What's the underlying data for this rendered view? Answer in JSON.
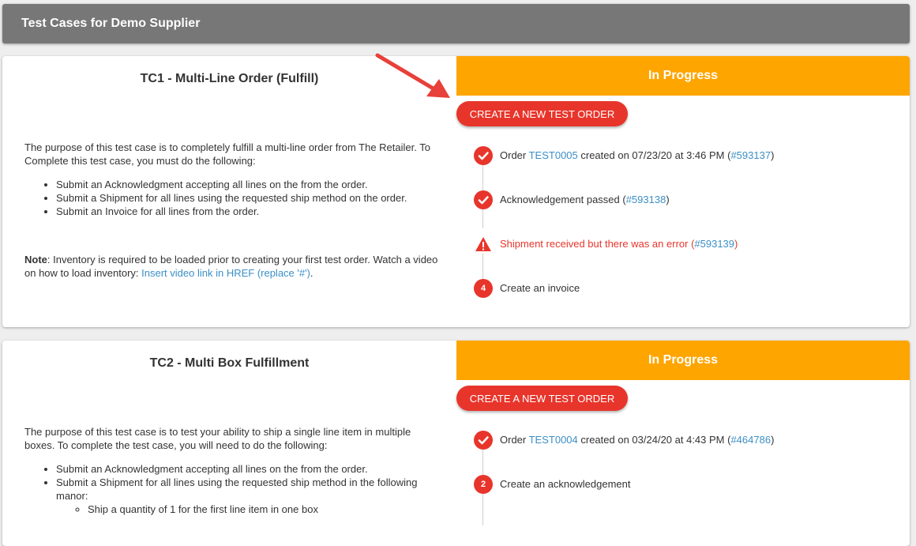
{
  "header": {
    "title": "Test Cases for Demo Supplier"
  },
  "colors": {
    "status": "#ffa500",
    "accent": "#e8352b",
    "link": "#3c8fc6",
    "header": "#777777"
  },
  "test_cases": [
    {
      "title": "TC1 - Multi-Line Order (Fulfill)",
      "status": "In Progress",
      "button_label": "CREATE A NEW TEST ORDER",
      "description": "The purpose of this test case is to completely fulfill a multi-line order from The Retailer. To Complete this test case, you must do the following:",
      "requirements": [
        "Submit an Acknowledgment accepting all lines on the from the order.",
        "Submit a Shipment for all lines using the requested ship method on the order.",
        "Submit an Invoice for all lines from the order."
      ],
      "note_label": "Note",
      "note_text": ": Inventory is required to be loaded prior to creating your first test order. Watch a video on how to load inventory: ",
      "note_link": "Insert video link in HREF (replace '#')",
      "note_end": ".",
      "steps": [
        {
          "state": "done",
          "icon": "check-icon",
          "pre": "Order ",
          "link1": "TEST0005",
          "mid": " created on 07/23/20 at 3:46 PM (",
          "link2": "#593137",
          "post": ")"
        },
        {
          "state": "done",
          "icon": "check-icon",
          "pre": "Acknowledgement passed (",
          "link2": "#593138",
          "post": ")"
        },
        {
          "state": "error",
          "icon": "warning-icon",
          "pre": "Shipment received but there was an error (",
          "link2": "#593139",
          "post": ")"
        },
        {
          "state": "pending",
          "number": "4",
          "pre": "Create an invoice"
        }
      ]
    },
    {
      "title": "TC2 - Multi Box Fulfillment",
      "status": "In Progress",
      "button_label": "CREATE A NEW TEST ORDER",
      "description": "The purpose of this test case is to test your ability to ship a single line item in multiple boxes. To complete the test case, you will need to do the following:",
      "requirements": [
        "Submit an Acknowledgment accepting all lines on the from the order.",
        "Submit a Shipment for all lines using the requested ship method in the following manor:"
      ],
      "sub_requirements": [
        "Ship a quantity of 1 for the first line item in one box"
      ],
      "steps": [
        {
          "state": "done",
          "icon": "check-icon",
          "pre": "Order ",
          "link1": "TEST0004",
          "mid": " created on 03/24/20 at 4:43 PM (",
          "link2": "#464786",
          "post": ")"
        },
        {
          "state": "pending",
          "number": "2",
          "pre": "Create an acknowledgement"
        }
      ]
    }
  ]
}
